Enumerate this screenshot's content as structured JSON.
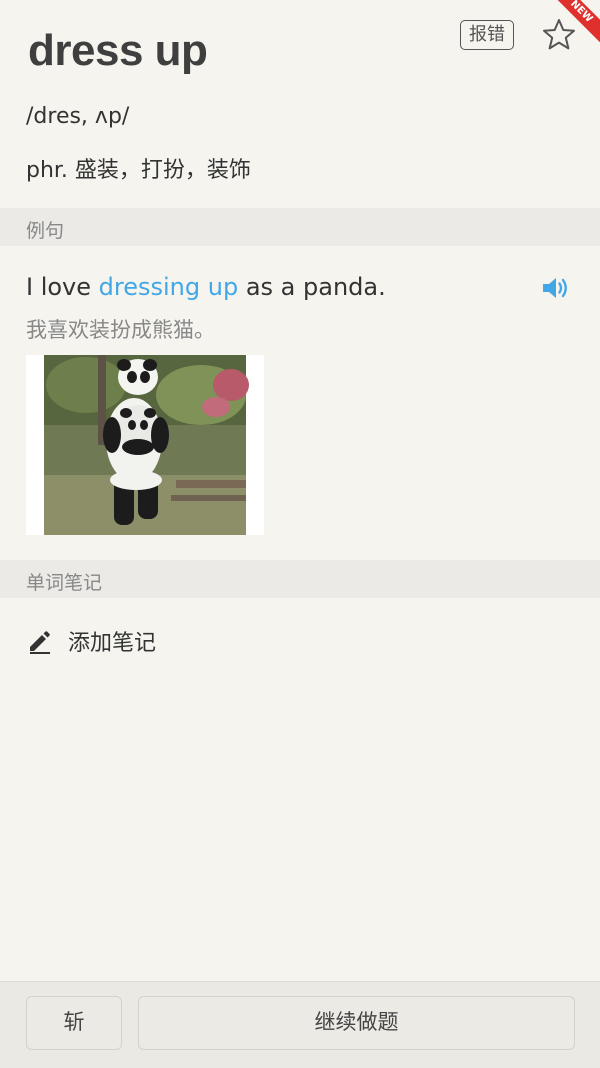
{
  "word": {
    "title": "dress up",
    "phonetic": "/dres, ʌp/",
    "definition": "phr. 盛装，打扮，装饰"
  },
  "header": {
    "report_label": "报错",
    "star_icon": "star-outline-icon",
    "new_badge": "NEW"
  },
  "sections": {
    "examples_title": "例句",
    "notes_title": "单词笔记"
  },
  "example": {
    "en_before": "I love ",
    "en_highlight": "dressing up",
    "en_after": " as a panda.",
    "cn": "我喜欢装扮成熊猫。",
    "speaker_icon": "speaker-icon",
    "image": "panda-costume-photo",
    "highlight_color": "#43a7e6"
  },
  "notes": {
    "add_label": "添加笔记",
    "add_icon": "pencil-icon"
  },
  "footer": {
    "cut_label": "斩",
    "continue_label": "继续做题"
  }
}
